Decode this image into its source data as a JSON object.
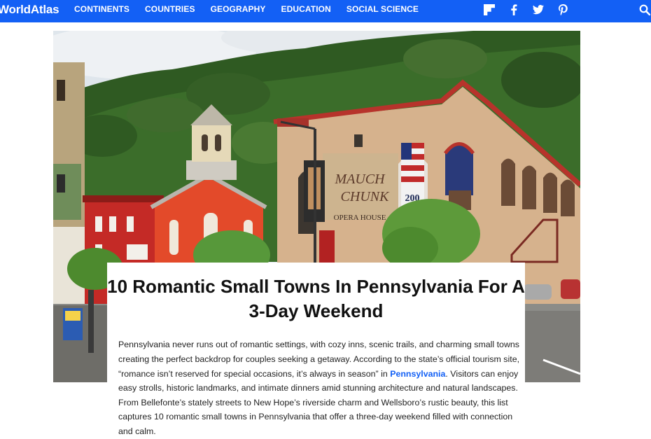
{
  "nav": {
    "logo": "WorldAtlas",
    "links": [
      "CONTINENTS",
      "COUNTRIES",
      "GEOGRAPHY",
      "EDUCATION",
      "SOCIAL SCIENCE"
    ],
    "social_icons": [
      "flipboard-icon",
      "facebook-icon",
      "twitter-icon",
      "pinterest-icon"
    ],
    "search_icon": "search-icon"
  },
  "hero": {
    "building_sign_line1": "MAUCH",
    "building_sign_line2": "CHUNK",
    "building_sign_line3": "OPERA HOUSE",
    "banner_number": "200"
  },
  "article": {
    "title": "10 Romantic Small Towns In Pennsylvania For A 3-Day Weekend",
    "intro_part1": "Pennsylvania never runs out of romantic settings, with cozy inns, scenic trails, and charming small towns creating the perfect backdrop for couples seeking a getaway. According to the state’s official tourism site, “romance isn’t reserved for special occasions, it’s always in season” in ",
    "intro_link": "Pennsylvania",
    "intro_part2": ". Visitors can enjoy easy strolls, historic landmarks, and intimate dinners amid stunning architecture and natural landscapes. From Bellefonte’s stately streets to New Hope’s riverside charm and Wellsboro’s rustic beauty, this list captures 10 romantic small towns in Pennsylvania that offer a three-day weekend filled with connection and calm."
  },
  "colors": {
    "brand_blue": "#1360f5",
    "link_blue": "#1360f5"
  }
}
